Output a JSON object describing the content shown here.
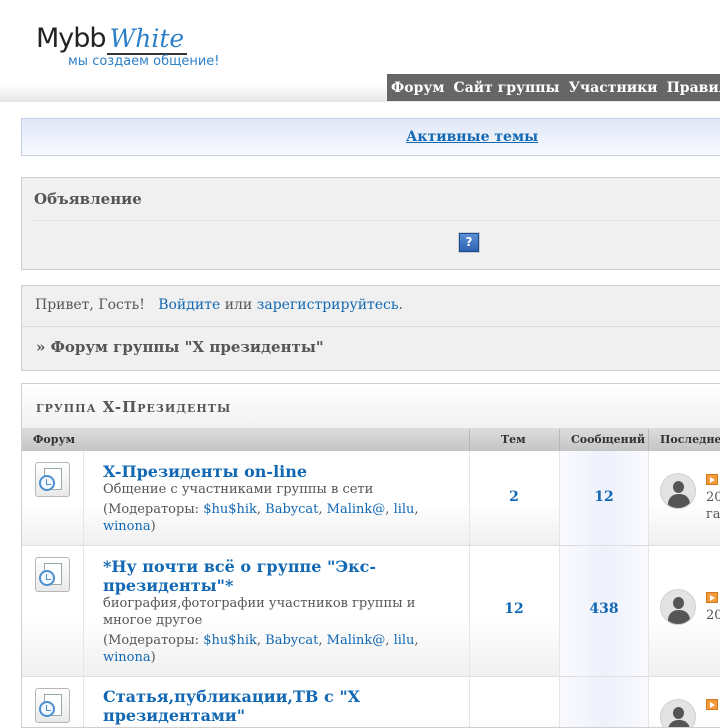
{
  "header": {
    "logo_main": "Mybb",
    "logo_script": "White",
    "logo_tagline": "мы создаем общение!",
    "nav": [
      "Форум",
      "Сайт группы",
      "Участники",
      "Правила"
    ]
  },
  "active_topics": {
    "label": "Активные темы"
  },
  "announcement": {
    "title": "Объявление",
    "help_icon": "?"
  },
  "welcome": {
    "greeting": "Привет, Гость!",
    "login": "Войдите",
    "or": "или",
    "register": "зарегистрируйтесь",
    "dot": ".",
    "breadcrumb": "» Форум группы \"X президенты\""
  },
  "category": {
    "title": "группа X-Президенты",
    "columns": {
      "forum": "Форум",
      "topics": "Тем",
      "posts": "Сообщений",
      "last": "Последне"
    },
    "forums": [
      {
        "title": "X-Президенты on-line",
        "description": "Общение с участниками группы в сети",
        "mods_label": "(Модераторы:",
        "mods": [
          "$hu$hik",
          "Babycat",
          "Malink@",
          "lilu",
          "winona"
        ],
        "mods_close": ")",
        "topics": "2",
        "posts": "12",
        "last_line1": "20",
        "last_line2": "га"
      },
      {
        "title_line1": "*Ну почти всё о группе \"Экс-",
        "title_line2": "президенты\"*",
        "description_line1": "биография,фотографии участников группы и",
        "description_line2": "многое другое",
        "mods_label": "(Модераторы:",
        "mods": [
          "$hu$hik",
          "Babycat",
          "Malink@",
          "lilu",
          "winona"
        ],
        "mods_close": ")",
        "topics": "12",
        "posts": "438",
        "last_line1": "20"
      },
      {
        "title_line1": "Статья,публикации,ТВ с \"X",
        "title_line2": "президентами\""
      }
    ]
  },
  "colors": {
    "link": "#1268b3",
    "nav_bg": "#666666",
    "accent": "#2d7fc8"
  }
}
